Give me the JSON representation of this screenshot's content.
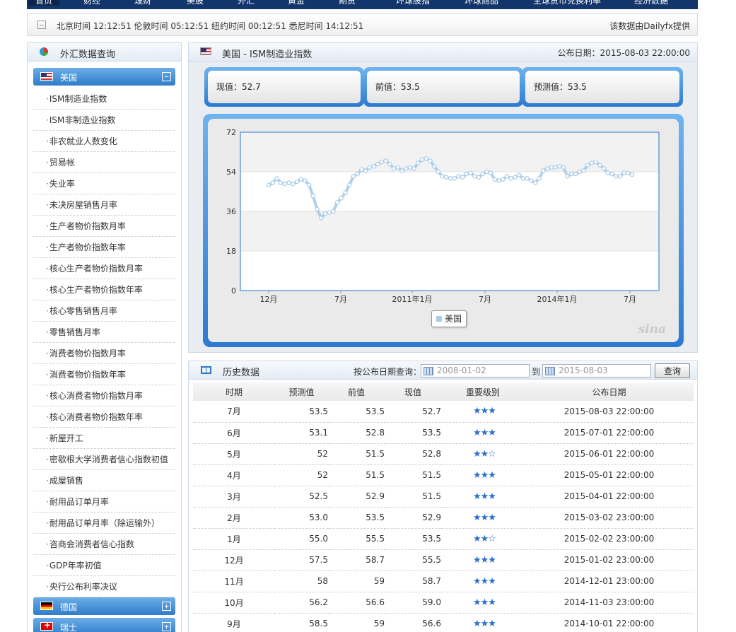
{
  "nav": {
    "items": [
      "首页",
      "财经",
      "理财",
      "美股",
      "外汇",
      "黄金",
      "期货",
      "环球股指",
      "环球商品",
      "全球货币兑换利率",
      "经济数据"
    ]
  },
  "ticker": {
    "times": "北京时间 12:12:51 伦敦时间 05:12:51 纽约时间 00:12:51 悉尼时间 14:12:51",
    "source": "该数据由Dailyfx提供"
  },
  "sidebar": {
    "title": "外汇数据查询",
    "countries": [
      {
        "label": "美国",
        "toggle": "−"
      },
      {
        "label": "德国",
        "toggle": "+"
      },
      {
        "label": "瑞士",
        "toggle": "+"
      }
    ],
    "indicators": [
      "ISM制造业指数",
      "ISM非制造业指数",
      "非农就业人数变化",
      "贸易帐",
      "失业率",
      "未决房屋销售月率",
      "生产者物价指数月率",
      "生产者物价指数年率",
      "核心生产者物价指数月率",
      "核心生产者物价指数年率",
      "核心零售销售月率",
      "零售销售月率",
      "消费者物价指数月率",
      "消费者物价指数年率",
      "核心消费者物价指数月率",
      "核心消费者物价指数年率",
      "新屋开工",
      "密歇根大学消费者信心指数初值",
      "成屋销售",
      "耐用品订单月率",
      "耐用品订单月率（除运输外）",
      "咨商会消费者信心指数",
      "GDP年率初值",
      "央行公布利率决议"
    ]
  },
  "main": {
    "title": "美国 - ISM制造业指数",
    "pub_date": "公布日期：2015-08-03 22:00:00",
    "stats": {
      "actual": "现值：52.7",
      "previous": "前值：53.5",
      "forecast": "预测值：53.5"
    },
    "watermark": "sina"
  },
  "chart_data": {
    "type": "line",
    "title": "",
    "xlabel": "",
    "ylabel": "",
    "ylim": [
      0,
      72
    ],
    "yticks": [
      0,
      18,
      36,
      54,
      72
    ],
    "xtick_labels": [
      "12月",
      "7月",
      "2011年1月",
      "7月",
      "2014年1月",
      "7月"
    ],
    "grid": "horizontal bands",
    "legend": "bottom-center",
    "series": [
      {
        "name": "美国",
        "color": "#a9cbe8",
        "values": [
          48,
          49,
          51,
          49,
          48.5,
          49,
          48.5,
          49.5,
          50.5,
          50,
          48,
          43,
          37,
          33,
          35,
          35.5,
          36,
          40,
          42,
          44.5,
          48,
          52,
          53,
          55,
          54.5,
          56,
          56.5,
          57.5,
          58.5,
          59,
          57.5,
          55.5,
          56,
          54.5,
          55.5,
          56,
          55.5,
          58,
          59.5,
          60,
          59,
          56.5,
          54,
          52,
          51.5,
          51,
          51,
          52,
          51.5,
          53,
          53.5,
          52,
          51.5,
          53,
          54,
          53.5,
          50.5,
          50,
          50.5,
          52,
          51,
          51.5,
          52.5,
          51,
          51,
          50,
          49,
          51,
          54.5,
          55.5,
          56,
          56,
          56.5,
          56,
          52,
          53,
          53,
          54,
          54.5,
          57,
          58,
          58.5,
          57,
          55.5,
          53.5,
          53,
          52,
          52,
          53.5,
          53.5,
          52.7
        ]
      }
    ]
  },
  "history": {
    "title": "历史数据",
    "query_label": "按公布日期查询：",
    "from_placeholder": "2008-01-02",
    "to_label": "到",
    "to_placeholder": "2015-08-03",
    "query_button": "查询",
    "columns": [
      "时期",
      "预测值",
      "前值",
      "现值",
      "重要级别",
      "公布日期"
    ],
    "rows": [
      {
        "period": "7月",
        "forecast": "53.5",
        "previous": "53.5",
        "actual": "52.7",
        "stars": "★★★",
        "date": "2015-08-03 22:00:00"
      },
      {
        "period": "6月",
        "forecast": "53.1",
        "previous": "52.8",
        "actual": "53.5",
        "stars": "★★★",
        "date": "2015-07-01 22:00:00"
      },
      {
        "period": "5月",
        "forecast": "52",
        "previous": "51.5",
        "actual": "52.8",
        "stars": "★★☆",
        "date": "2015-06-01 22:00:00"
      },
      {
        "period": "4月",
        "forecast": "52",
        "previous": "51.5",
        "actual": "51.5",
        "stars": "★★★",
        "date": "2015-05-01 22:00:00"
      },
      {
        "period": "3月",
        "forecast": "52.5",
        "previous": "52.9",
        "actual": "51.5",
        "stars": "★★★",
        "date": "2015-04-01 22:00:00"
      },
      {
        "period": "2月",
        "forecast": "53.0",
        "previous": "53.5",
        "actual": "52.9",
        "stars": "★★★",
        "date": "2015-03-02 23:00:00"
      },
      {
        "period": "1月",
        "forecast": "55.0",
        "previous": "55.5",
        "actual": "53.5",
        "stars": "★★☆",
        "date": "2015-02-02 23:00:00"
      },
      {
        "period": "12月",
        "forecast": "57.5",
        "previous": "58.7",
        "actual": "55.5",
        "stars": "★★★",
        "date": "2015-01-02 23:00:00"
      },
      {
        "period": "11月",
        "forecast": "58",
        "previous": "59",
        "actual": "58.7",
        "stars": "★★★",
        "date": "2014-12-01 23:00:00"
      },
      {
        "period": "10月",
        "forecast": "56.2",
        "previous": "56.6",
        "actual": "59.0",
        "stars": "★★★",
        "date": "2014-11-03 23:00:00"
      },
      {
        "period": "9月",
        "forecast": "58.5",
        "previous": "59",
        "actual": "56.6",
        "stars": "★★★",
        "date": "2014-10-01 22:00:00"
      }
    ]
  }
}
